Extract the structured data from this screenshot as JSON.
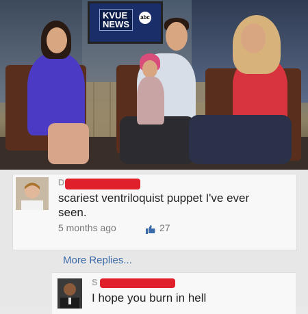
{
  "video": {
    "news_logo": "KVUE\nNEWS",
    "network_logo": "abc"
  },
  "comment": {
    "author": "D",
    "text": "scariest ventriloquist puppet I've ever seen.",
    "timestamp": "5 months ago",
    "likes": "27"
  },
  "more_replies_label": "More Replies...",
  "reply": {
    "author": "S",
    "text": "I hope you burn in hell"
  },
  "colors": {
    "redaction": "#e0202a",
    "link": "#3b6aa8",
    "thumb": "#3b6aa8"
  }
}
